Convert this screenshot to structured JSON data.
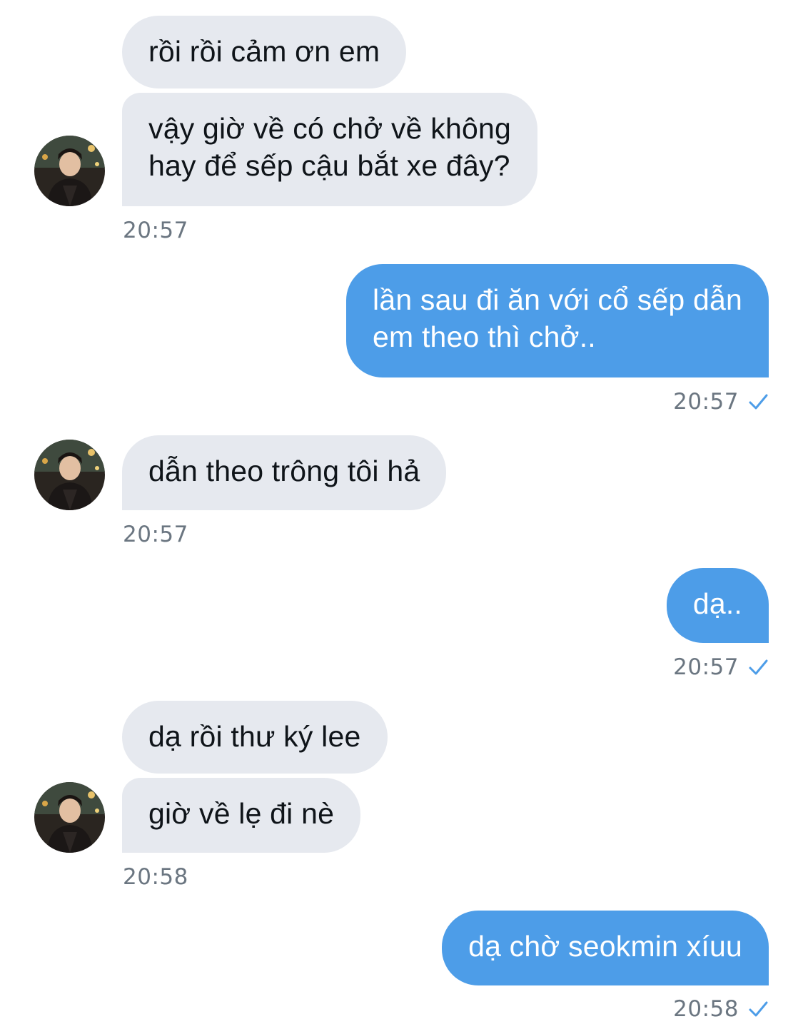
{
  "messages": [
    {
      "side": "in",
      "text": "rồi rồi cảm ơn em"
    },
    {
      "side": "in",
      "lines": [
        "vậy giờ về có chở về không",
        "hay để sếp cậu bắt xe đây?"
      ]
    },
    {
      "side": "out",
      "lines": [
        "lần sau đi ăn với cổ sếp dẫn",
        "em theo thì chở.."
      ]
    },
    {
      "side": "in",
      "text": "dẫn theo trông tôi hả"
    },
    {
      "side": "out",
      "text": "dạ.."
    },
    {
      "side": "in",
      "text": "dạ rồi thư ký lee"
    },
    {
      "side": "in",
      "text": "giờ về lẹ đi nè"
    },
    {
      "side": "out",
      "text": "dạ chờ seokmin xíuu"
    }
  ],
  "timestamps": {
    "t1": "20:57",
    "t2": "20:57",
    "t3": "20:57",
    "t4": "20:57",
    "t5": "20:58",
    "t6": "20:58"
  },
  "icons": {
    "read_check": "check-icon",
    "avatar": "contact-avatar"
  },
  "colors": {
    "incoming_bubble": "#e6e9ef",
    "outgoing_bubble": "#4d9de8",
    "timestamp": "#6b7681",
    "check": "#4d9de8"
  }
}
